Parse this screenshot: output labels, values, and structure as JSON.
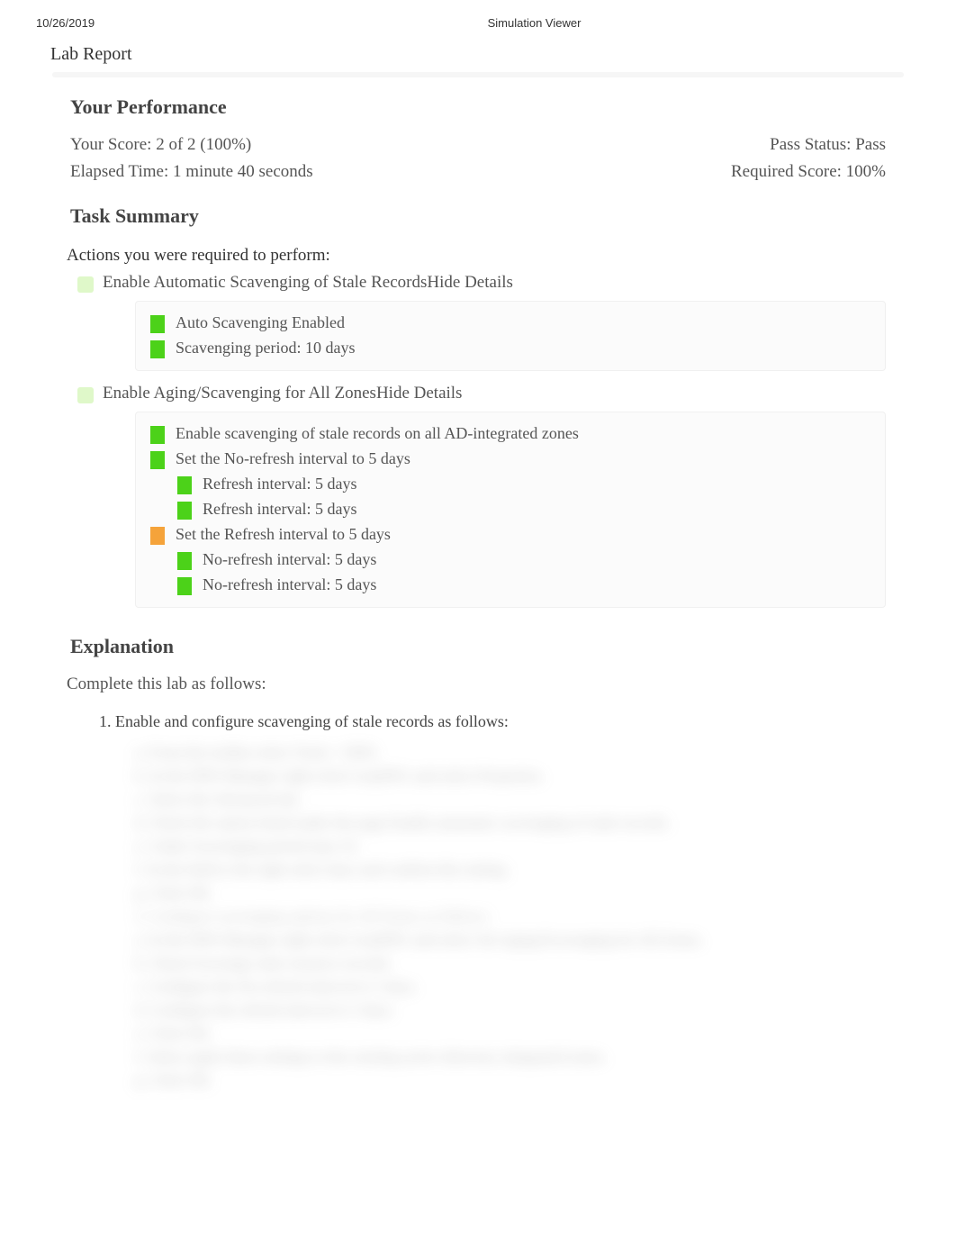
{
  "header": {
    "date": "10/26/2019",
    "app": "Simulation Viewer"
  },
  "report_title": "Lab Report",
  "performance": {
    "heading": "Your Performance",
    "score_label": "Your Score: ",
    "score_value": "2 of 2 (100%)",
    "elapsed_label": "Elapsed Time: ",
    "elapsed_value": "1 minute 40 seconds",
    "pass_label": "Pass Status: ",
    "pass_value": "Pass",
    "required_label": "Required Score: ",
    "required_value": "100%"
  },
  "task_summary": {
    "heading": "Task Summary",
    "actions_label": "Actions you were required to perform:",
    "tasks": [
      {
        "title": "Enable Automatic Scavenging of Stale Records",
        "toggle": "Hide Details",
        "details": [
          {
            "text": "Auto Scavenging Enabled",
            "color": "green",
            "indent": 1
          },
          {
            "text": "Scavenging period: 10 days",
            "color": "green",
            "indent": 1
          }
        ]
      },
      {
        "title": "Enable Aging/Scavenging for All Zones",
        "toggle": "Hide Details",
        "details": [
          {
            "text": "Enable scavenging of stale records on all AD-integrated zones",
            "color": "green",
            "indent": 1
          },
          {
            "text": "Set the No-refresh interval to 5 days",
            "color": "green",
            "indent": 1
          },
          {
            "text": "Refresh interval: 5 days",
            "color": "green",
            "indent": 2
          },
          {
            "text": "Refresh interval: 5 days",
            "color": "green",
            "indent": 2
          },
          {
            "text": "Set the Refresh interval to 5 days",
            "color": "orange",
            "indent": 1
          },
          {
            "text": "No-refresh interval: 5 days",
            "color": "green",
            "indent": 2
          },
          {
            "text": "No-refresh interval: 5 days",
            "color": "green",
            "indent": 2
          }
        ]
      }
    ]
  },
  "explanation": {
    "heading": "Explanation",
    "intro": "Complete this lab as follows:",
    "step1": "1. Enable and configure scavenging of stale records as follows:"
  }
}
